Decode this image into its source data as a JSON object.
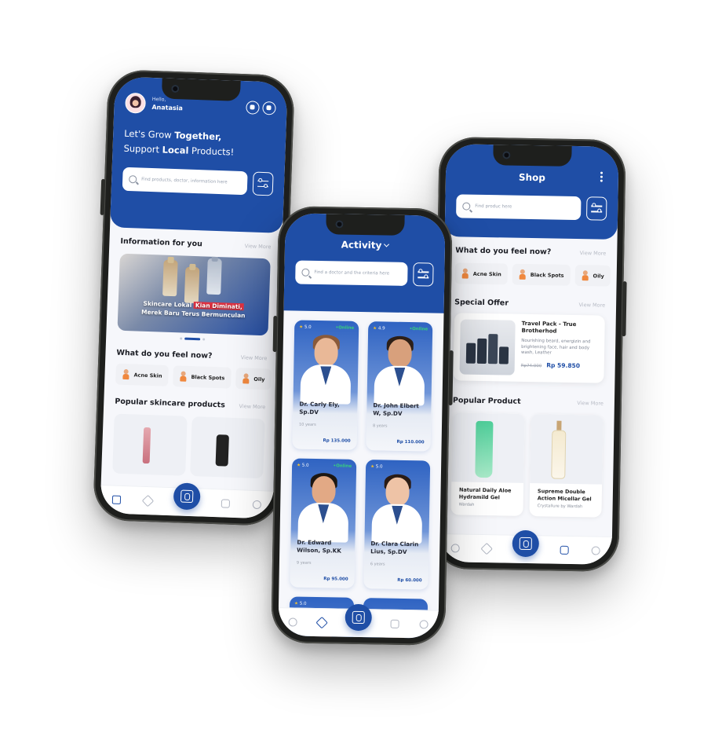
{
  "home": {
    "greeting": "Hello,",
    "user_name": "Anatasia",
    "tagline_line1_prefix": "Let's Grow ",
    "tagline_line1_bold": "Together,",
    "tagline_line2_prefix": "Support ",
    "tagline_line2_bold": "Local",
    "tagline_line2_suffix": " Products!",
    "search_placeholder": "Find products, doctor, information here",
    "info_section_title": "Information for you",
    "view_more": "View More",
    "banner_line1_prefix": "Skincare Lokal ",
    "banner_line1_highlight": "Kian Diminati,",
    "banner_line2": "Merek Baru Terus Bermunculan",
    "feel_title": "What do you feel now?",
    "chips": [
      "Acne Skin",
      "Black Spots",
      "Oily"
    ],
    "popular_title": "Popular skincare products"
  },
  "activity": {
    "title": "Activity",
    "search_placeholder": "Find a doctor and the criteria here",
    "doctors": [
      {
        "rating": "5.0",
        "online": "Online",
        "name": "Dr. Carly Ely, Sp.DV",
        "years": "10 years",
        "price": "Rp 135.000"
      },
      {
        "rating": "4.9",
        "online": "Online",
        "name": "Dr. John Elbert W, Sp.DV",
        "years": "8 years",
        "price": "Rp 110.000"
      },
      {
        "rating": "5.0",
        "online": "Online",
        "name": "Dr. Edward Wilson, Sp.KK",
        "years": "9 years",
        "price": "Rp 95.000"
      },
      {
        "rating": "5.0",
        "online": "",
        "name": "Dr. Clara Clarin Lius, Sp.DV",
        "years": "6 years",
        "price": "Rp 60.000"
      },
      {
        "rating": "5.0",
        "online": "",
        "name": "",
        "years": "",
        "price": ""
      },
      {
        "rating": "",
        "online": "",
        "name": "",
        "years": "",
        "price": ""
      }
    ]
  },
  "shop": {
    "title": "Shop",
    "search_placeholder": "Find produc here",
    "feel_title": "What do you feel now?",
    "view_more": "View More",
    "chips": [
      "Acne Skin",
      "Black Spots",
      "Oily"
    ],
    "offer_title": "Special Offer",
    "offer_name": "Travel Pack - True Brotherhod",
    "offer_desc": "Nourishing beard, energizin and brightening face, hair and body wash, Leather",
    "offer_old_price": "Rp74.000",
    "offer_new_price": "Rp 59.850",
    "popular_title": "Popular Product",
    "products": [
      {
        "name": "Natural Daily Aloe Hydramild Gel",
        "brand": "Wardah"
      },
      {
        "name": "Supreme Double Action Micellar Gel",
        "brand": "Crystallure by Wardah"
      }
    ]
  },
  "colors": {
    "brand_blue": "#1f4ea6",
    "online_green": "#36d07c",
    "highlight_red": "#e03241"
  }
}
